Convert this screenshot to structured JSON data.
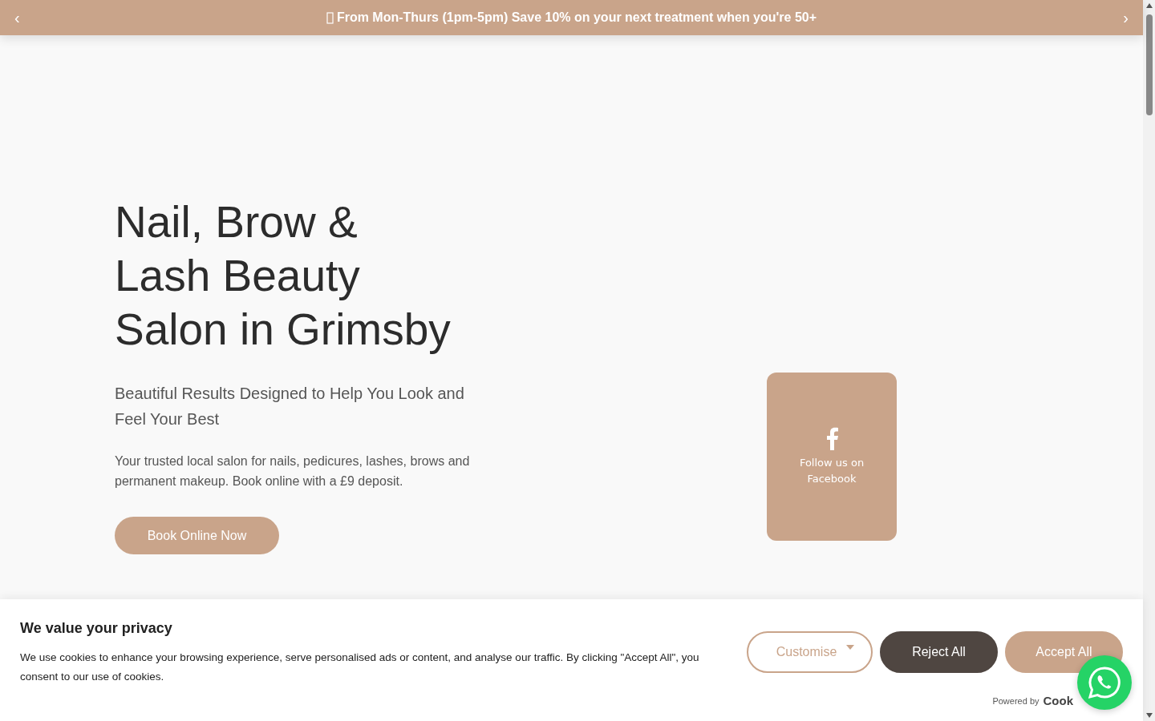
{
  "announcement": {
    "prev": "‹",
    "text": "From Mon-Thurs (1pm-5pm) Save 10% on your next treatment when you're 50+",
    "next": "›"
  },
  "hero": {
    "heading": [
      "Nail, Brow &",
      "Lash Beauty",
      "Salon in Grimsby"
    ],
    "subheading": "Beautiful Results Designed to Help You Look and Feel Your Best",
    "body": "Your trusted local salon for nails, pedicures, lashes, brows and permanent makeup. Book online with a £9 deposit.",
    "button": "Book Online Now"
  },
  "facebook_card": {
    "label": "Follow us on Facebook"
  },
  "cookie_banner": {
    "title": "We value your privacy",
    "text": "We use cookies to enhance your browsing experience, serve personalised ads or content, and analyse our traffic. By clicking \"Accept All\", you consent to our use of cookies.",
    "buttons": [
      {
        "kind": "dropdown",
        "label": "Customise"
      },
      {
        "kind": "dark",
        "label": "Reject All"
      },
      {
        "kind": "accent",
        "label": "Accept All"
      }
    ],
    "powered_by": "Powered by",
    "brand": "Cook"
  }
}
